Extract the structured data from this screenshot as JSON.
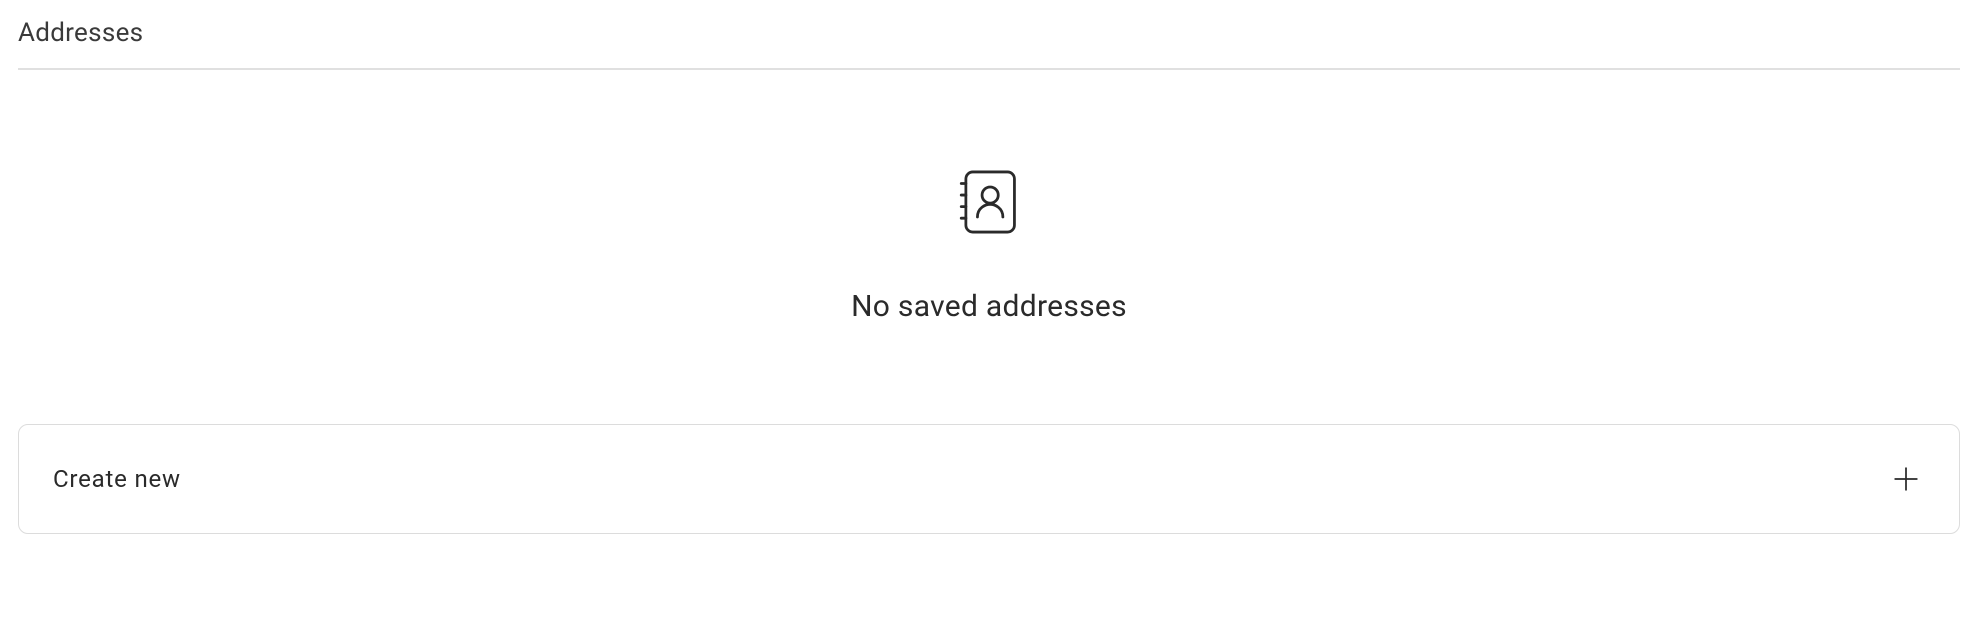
{
  "section": {
    "title": "Addresses"
  },
  "emptyState": {
    "message": "No saved addresses"
  },
  "createAction": {
    "label": "Create new"
  }
}
